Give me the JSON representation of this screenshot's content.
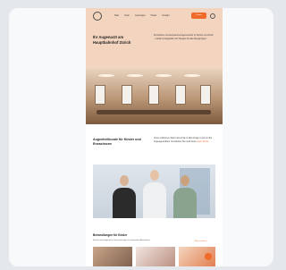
{
  "nav": {
    "links": [
      "Start",
      "Team",
      "Leistungen",
      "Praxis",
      "Kontakt"
    ],
    "cta_label": "Termin"
  },
  "hero": {
    "title": "Ihr Augenarzt am Hauptbahnhof Zürich",
    "text": "Persönliche und kompetente Augenmedizin im Herzen von Zürich – moderne Diagnostik und Therapie für alle Altersgruppen."
  },
  "section2": {
    "title": "Augenheilkunde für Kinder und Erwachsene",
    "text": "Unser erfahrenes Team betreut Sie in allen Fragen rund um Ihre Augengesundheit. Vereinbaren Sie noch heute",
    "link": "einen Termin."
  },
  "section3": {
    "title": "Behandlungen für Kinder",
    "text": "Sanfte und kindgerechte Untersuchungen in entspannter Atmosphäre.",
    "more_link": "Mehr erfahren"
  },
  "colors": {
    "accent": "#f06a2a",
    "hero_background": "#f3d5bf",
    "page_background": "#e4e8ed"
  },
  "icons": {
    "logo": "logo-icon",
    "language": "globe-icon",
    "scroll_top": "arrow-up-icon"
  }
}
